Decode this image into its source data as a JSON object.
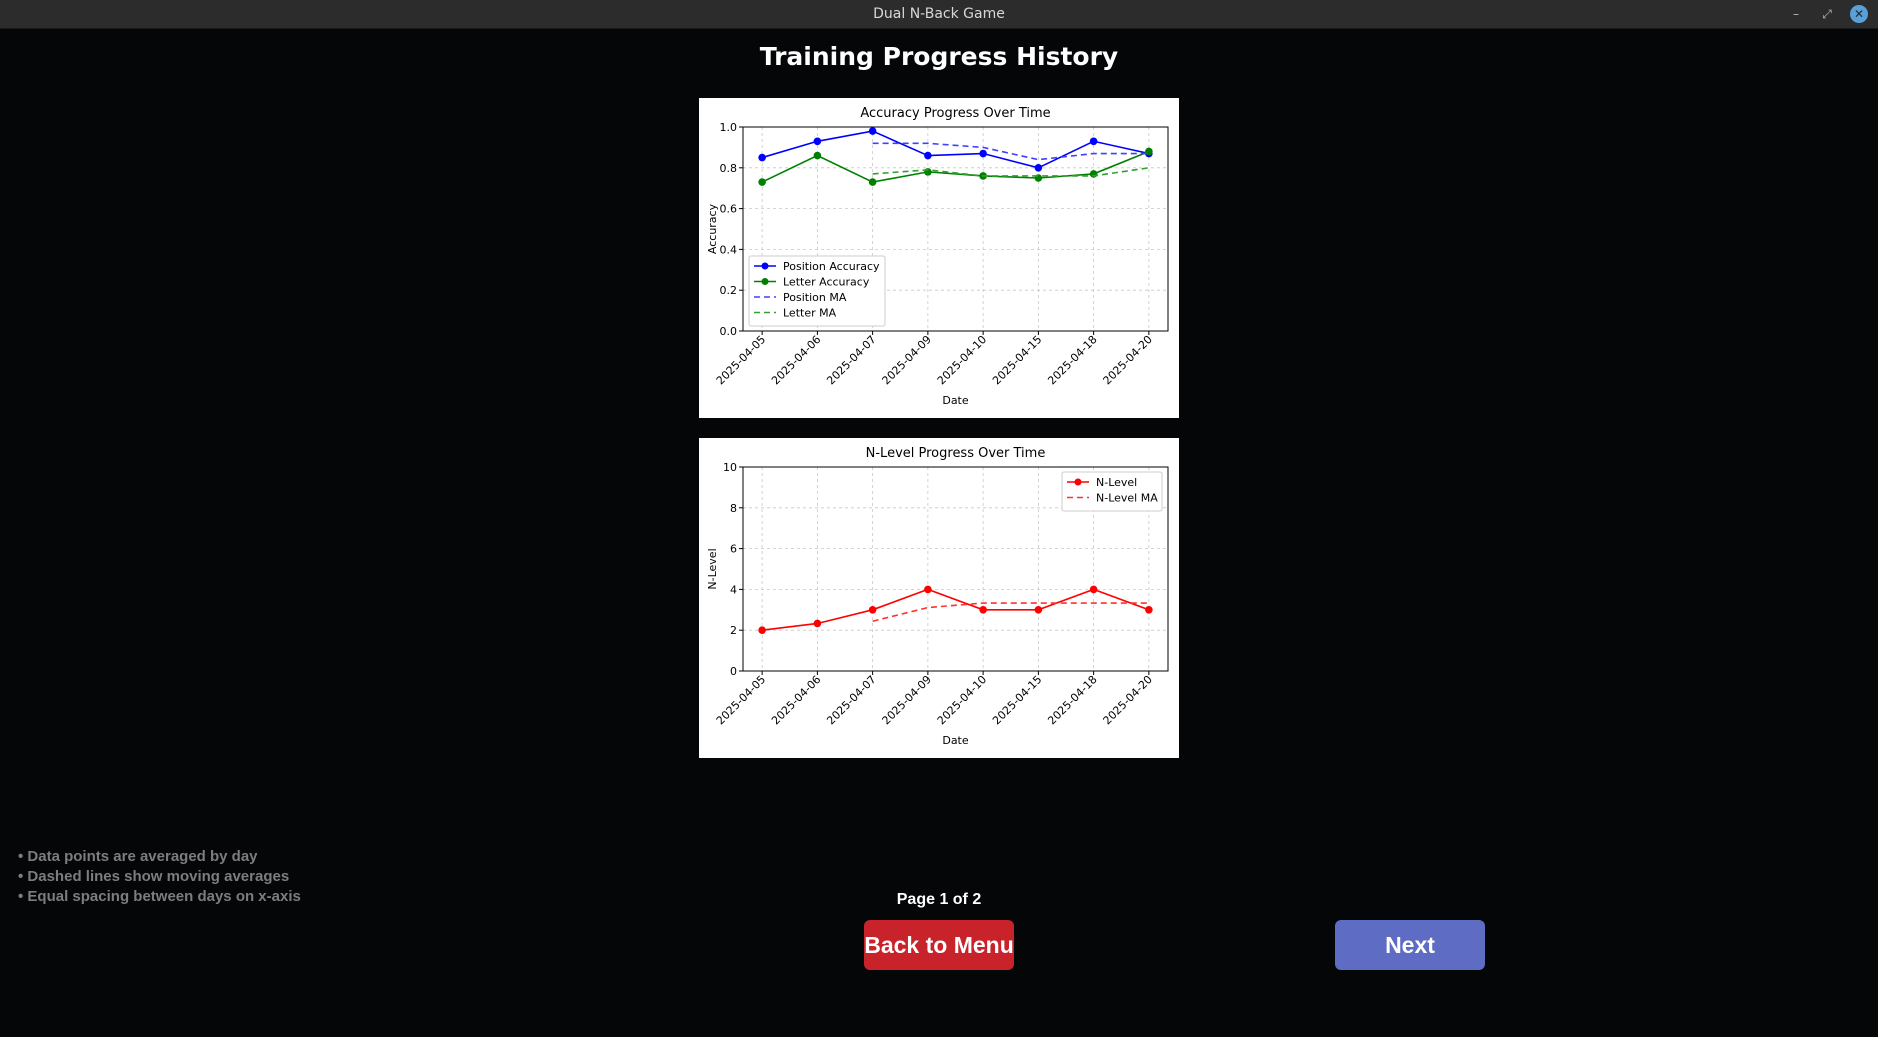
{
  "window": {
    "title": "Dual N-Back Game",
    "controls": [
      "minimize-icon",
      "restore-icon",
      "close-icon"
    ]
  },
  "page_title": "Training Progress History",
  "notes": [
    "• Data points are averaged by day",
    "• Dashed lines show moving averages",
    "• Equal spacing between days on x-axis"
  ],
  "pagination": {
    "indicator": "Page 1 of 2"
  },
  "buttons": {
    "back": "Back to Menu",
    "next": "Next",
    "back_color": "#c8232a",
    "next_color": "#5e6dc3"
  },
  "chart_data": [
    {
      "type": "line",
      "title": "Accuracy Progress Over Time",
      "xlabel": "Date",
      "ylabel": "Accuracy",
      "x": [
        "2025-04-05",
        "2025-04-06",
        "2025-04-07",
        "2025-04-09",
        "2025-04-10",
        "2025-04-15",
        "2025-04-18",
        "2025-04-20"
      ],
      "ylim": [
        0,
        1.0
      ],
      "yticks": [
        0.0,
        0.2,
        0.4,
        0.6,
        0.8,
        1.0
      ],
      "ytick_labels": [
        "0.0",
        "0.2",
        "0.4",
        "0.6",
        "0.8",
        "1.0"
      ],
      "grid": true,
      "legend_position": "lower-left",
      "series": [
        {
          "name": "Position Accuracy",
          "style": "solid",
          "marker": true,
          "color": "#0000ff",
          "values": [
            0.85,
            0.93,
            0.98,
            0.86,
            0.87,
            0.8,
            0.93,
            0.87
          ]
        },
        {
          "name": "Letter Accuracy",
          "style": "solid",
          "marker": true,
          "color": "#008000",
          "values": [
            0.73,
            0.86,
            0.73,
            0.78,
            0.76,
            0.75,
            0.77,
            0.88
          ]
        },
        {
          "name": "Position MA",
          "style": "dashed",
          "marker": false,
          "color": "#4040ff",
          "values": [
            null,
            null,
            0.92,
            0.92,
            0.9,
            0.84,
            0.87,
            0.87
          ]
        },
        {
          "name": "Letter MA",
          "style": "dashed",
          "marker": false,
          "color": "#33a033",
          "values": [
            null,
            null,
            0.77,
            0.79,
            0.76,
            0.76,
            0.76,
            0.8
          ]
        }
      ]
    },
    {
      "type": "line",
      "title": "N-Level Progress Over Time",
      "xlabel": "Date",
      "ylabel": "N-Level",
      "x": [
        "2025-04-05",
        "2025-04-06",
        "2025-04-07",
        "2025-04-09",
        "2025-04-10",
        "2025-04-15",
        "2025-04-18",
        "2025-04-20"
      ],
      "ylim": [
        0,
        10
      ],
      "yticks": [
        0,
        2,
        4,
        6,
        8,
        10
      ],
      "ytick_labels": [
        "0",
        "2",
        "4",
        "6",
        "8",
        "10"
      ],
      "grid": true,
      "legend_position": "upper-right",
      "series": [
        {
          "name": "N-Level",
          "style": "solid",
          "marker": true,
          "color": "#ff0000",
          "values": [
            2.0,
            2.33,
            3.0,
            4.0,
            3.0,
            3.0,
            4.0,
            3.0
          ]
        },
        {
          "name": "N-Level MA",
          "style": "dashed",
          "marker": false,
          "color": "#ff3030",
          "values": [
            null,
            null,
            2.44,
            3.11,
            3.33,
            3.33,
            3.33,
            3.33
          ]
        }
      ]
    }
  ]
}
